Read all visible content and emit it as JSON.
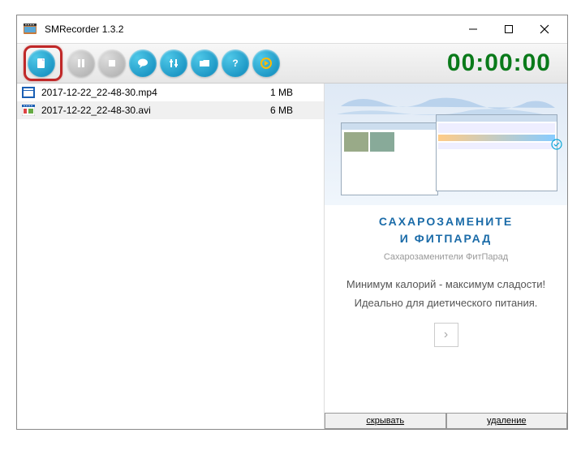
{
  "window": {
    "title": "SMRecorder 1.3.2"
  },
  "toolbar": {
    "timer": "00:00:00"
  },
  "files": [
    {
      "name": "2017-12-22_22-48-30.mp4",
      "size": "1 MB",
      "type": "mp4"
    },
    {
      "name": "2017-12-22_22-48-30.avi",
      "size": "6 MB",
      "type": "avi"
    }
  ],
  "ad": {
    "headline_line1": "САХАРОЗАМЕНИТЕ",
    "headline_line2": "И ФИТПАРАД",
    "subtitle": "Сахарозаменители ФитПарад",
    "body": "Минимум калорий - максимум сладости! Идеально для диетического питания.",
    "arrow": "›",
    "hide_label": "скрывать",
    "delete_label": "удаление"
  }
}
